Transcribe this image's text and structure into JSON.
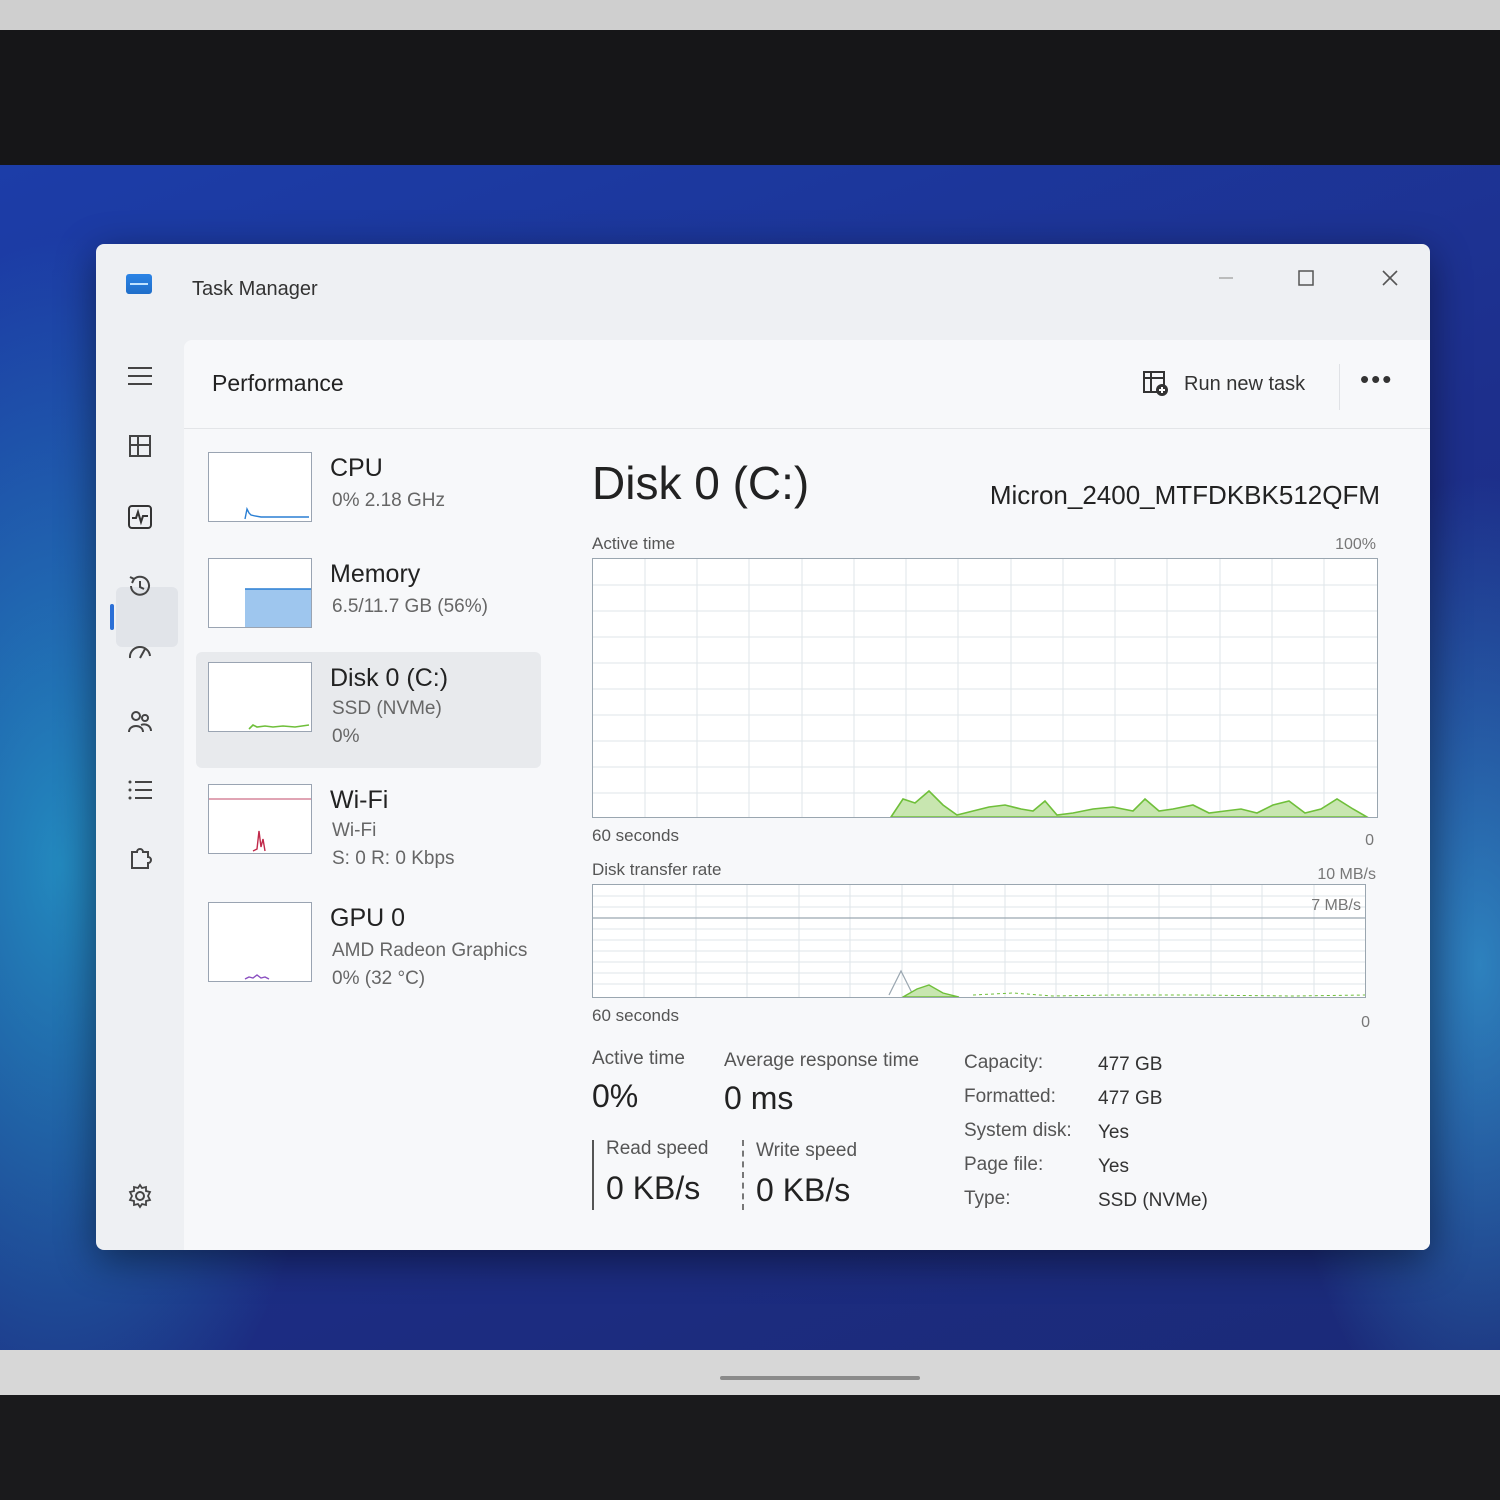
{
  "window": {
    "title": "Task Manager"
  },
  "header": {
    "section": "Performance",
    "run_new_task": "Run new task",
    "more": "•••"
  },
  "devices": [
    {
      "name": "CPU",
      "line1": "0%  2.18 GHz",
      "line2": ""
    },
    {
      "name": "Memory",
      "line1": "6.5/11.7 GB (56%)",
      "line2": ""
    },
    {
      "name": "Disk 0 (C:)",
      "line1": "SSD (NVMe)",
      "line2": "0%"
    },
    {
      "name": "Wi-Fi",
      "line1": "Wi-Fi",
      "line2": "S: 0  R: 0 Kbps"
    },
    {
      "name": "GPU 0",
      "line1": "AMD Radeon Graphics",
      "line2": "0%  (32 °C)"
    }
  ],
  "detail": {
    "title": "Disk 0 (C:)",
    "model": "Micron_2400_MTFDKBK512QFM",
    "active_graph": {
      "label": "Active time",
      "max": "100%",
      "xlabel": "60 seconds",
      "min": "0"
    },
    "transfer_graph": {
      "label": "Disk transfer rate",
      "max": "10 MB/s",
      "inner": "7 MB/s",
      "xlabel": "60 seconds",
      "min": "0"
    },
    "stats": {
      "active_time_label": "Active time",
      "active_time_value": "0%",
      "avg_resp_label": "Average response time",
      "avg_resp_value": "0 ms",
      "read_label": "Read speed",
      "read_value": "0 KB/s",
      "write_label": "Write speed",
      "write_value": "0 KB/s"
    },
    "props": [
      {
        "key": "Capacity:",
        "value": "477 GB"
      },
      {
        "key": "Formatted:",
        "value": "477 GB"
      },
      {
        "key": "System disk:",
        "value": "Yes"
      },
      {
        "key": "Page file:",
        "value": "Yes"
      },
      {
        "key": "Type:",
        "value": "SSD (NVMe)"
      }
    ]
  },
  "colors": {
    "accent": "#2b6fd6",
    "disk_green": "#6fbf3a",
    "memory_blue": "#9ec6ee"
  }
}
